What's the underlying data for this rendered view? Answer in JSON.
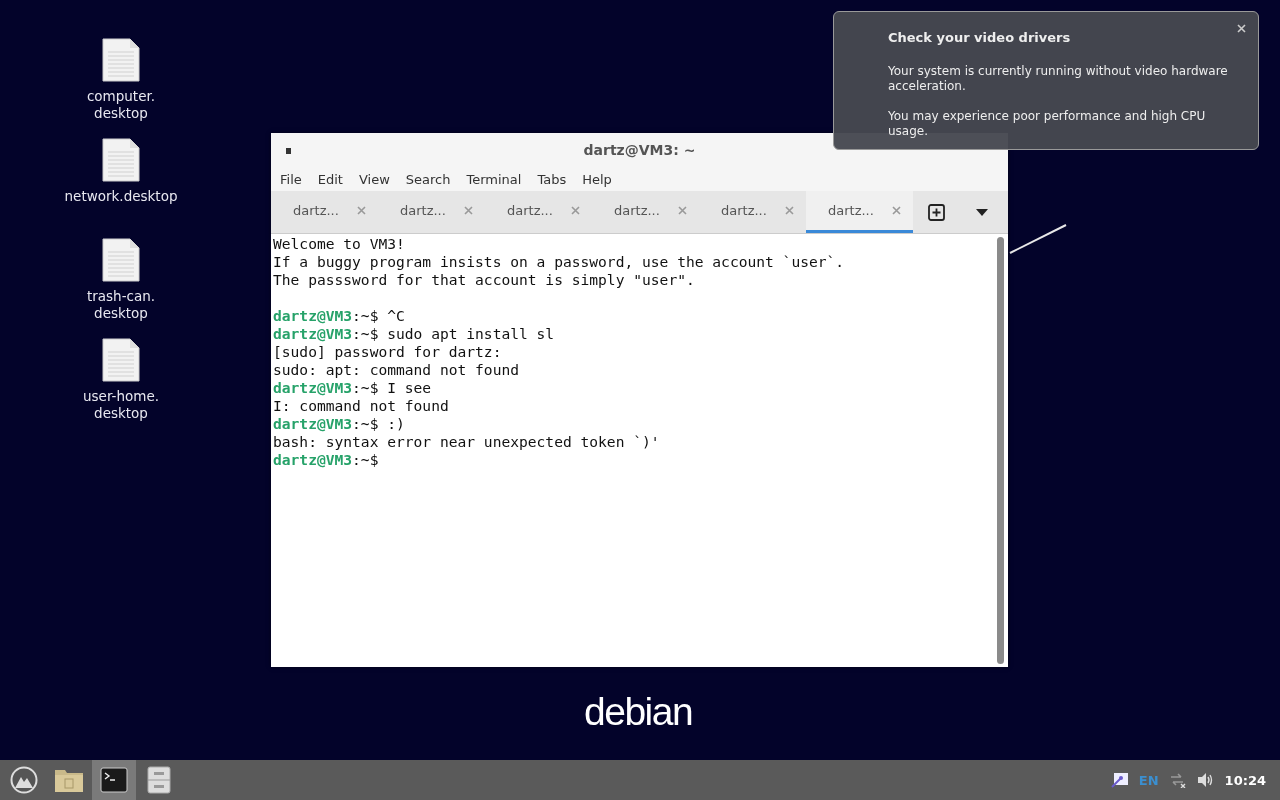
{
  "desktop_icons": [
    {
      "label": "computer.\ndesktop"
    },
    {
      "label": "network.desktop"
    },
    {
      "label": "trash-can.\ndesktop"
    },
    {
      "label": "user-home.\ndesktop"
    }
  ],
  "wallpaper": {
    "logo": "debian"
  },
  "terminal_window": {
    "title": "dartz@VM3: ~",
    "menu": [
      "File",
      "Edit",
      "View",
      "Search",
      "Terminal",
      "Tabs",
      "Help"
    ],
    "tabs": [
      {
        "label": "dartz...",
        "selected": false
      },
      {
        "label": "dartz...",
        "selected": false
      },
      {
        "label": "dartz...",
        "selected": false
      },
      {
        "label": "dartz...",
        "selected": false
      },
      {
        "label": "dartz...",
        "selected": false
      },
      {
        "label": "dartz...",
        "selected": true
      }
    ],
    "lines": [
      {
        "kind": "output",
        "text": "Welcome to VM3!"
      },
      {
        "kind": "output",
        "text": "If a buggy program insists on a password, use the account `user`."
      },
      {
        "kind": "output",
        "text": "The passsword for that account is simply \"user\"."
      },
      {
        "kind": "blank"
      },
      {
        "kind": "prompt",
        "user": "dartz@VM3",
        "text": ":~$ ^C"
      },
      {
        "kind": "prompt",
        "user": "dartz@VM3",
        "text": ":~$ sudo apt install sl"
      },
      {
        "kind": "output",
        "text": "[sudo] password for dartz:"
      },
      {
        "kind": "output",
        "text": "sudo: apt: command not found"
      },
      {
        "kind": "prompt",
        "user": "dartz@VM3",
        "text": ":~$ I see"
      },
      {
        "kind": "output",
        "text": "I: command not found"
      },
      {
        "kind": "prompt",
        "user": "dartz@VM3",
        "text": ":~$ :)"
      },
      {
        "kind": "output",
        "text": "bash: syntax error near unexpected token `)'"
      },
      {
        "kind": "prompt",
        "user": "dartz@VM3",
        "text": ":~$"
      }
    ]
  },
  "notification": {
    "title": "Check your video drivers",
    "paragraphs": [
      "Your system is currently running without video hardware acceleration.",
      "You may experience poor performance and high CPU usage."
    ]
  },
  "taskbar": {
    "apps": [
      {
        "kind": "launcher",
        "active": false
      },
      {
        "kind": "folder",
        "active": false
      },
      {
        "kind": "terminal",
        "active": true
      },
      {
        "kind": "cabinet",
        "active": false
      }
    ],
    "keyboard_layout": "EN",
    "clock": "10:24"
  }
}
